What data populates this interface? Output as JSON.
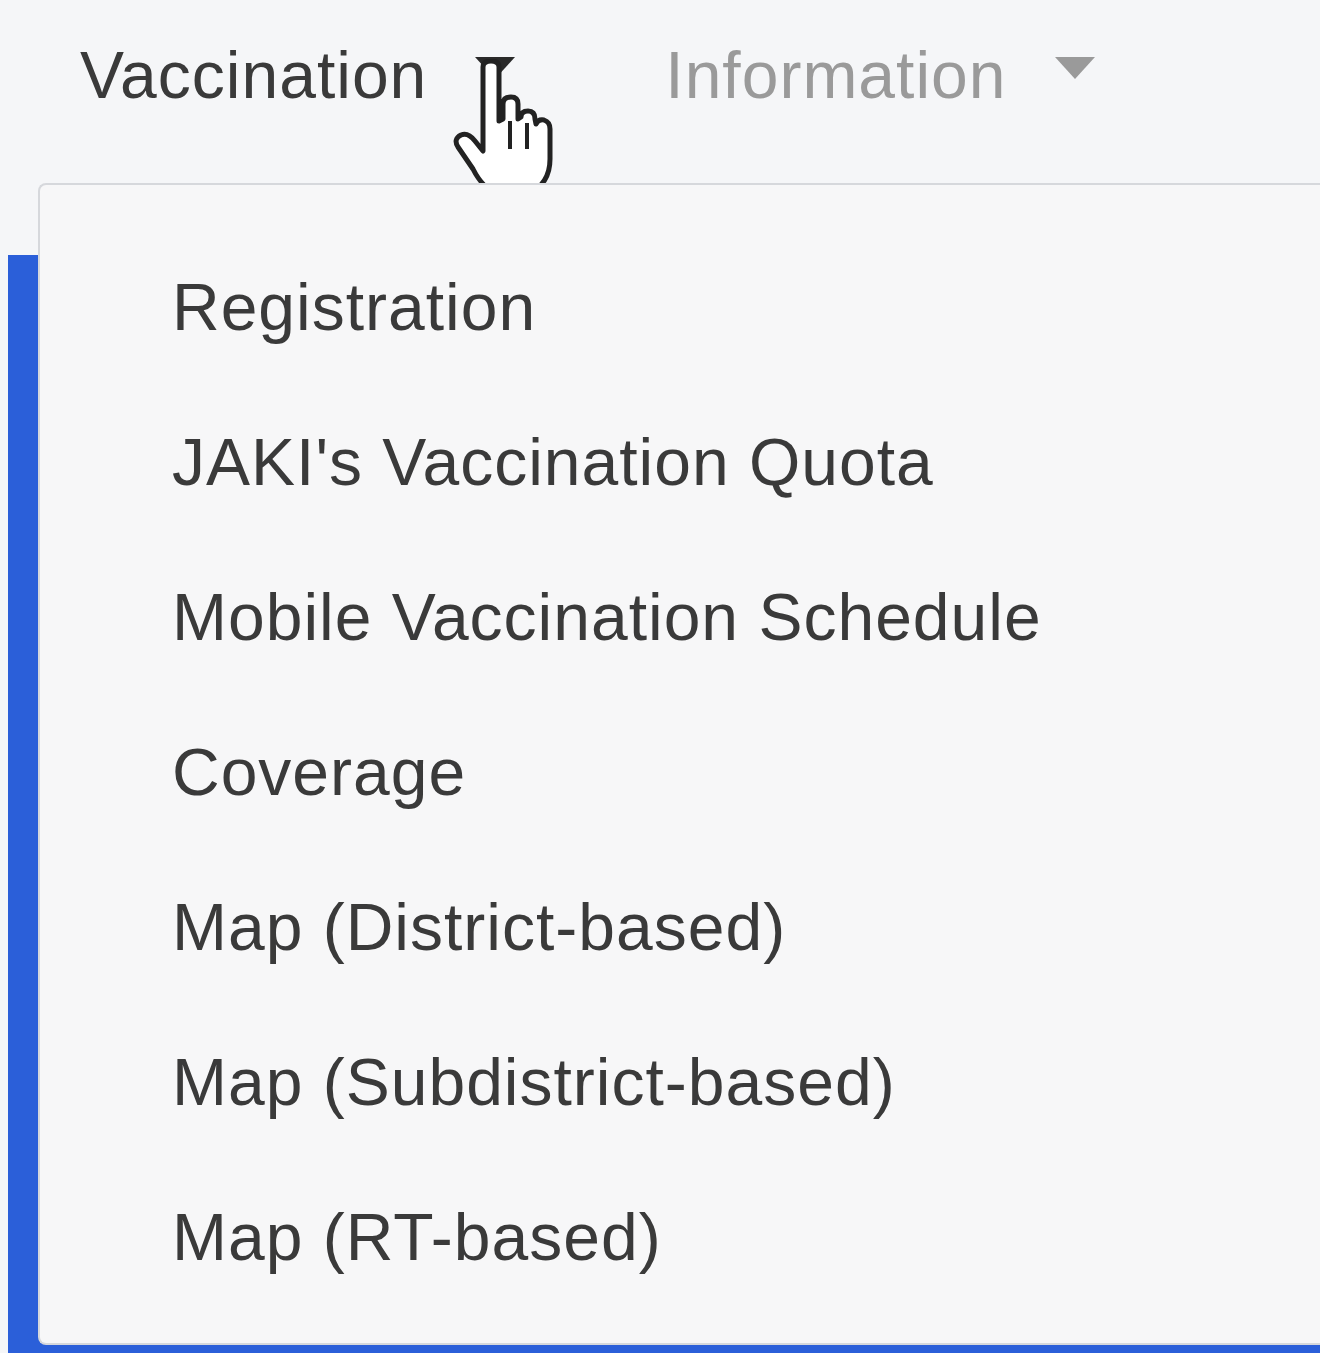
{
  "nav": [
    {
      "label": "Vaccination",
      "selected": true
    },
    {
      "label": "Information",
      "selected": false
    }
  ],
  "dropdown": {
    "items": [
      {
        "label": "Registration"
      },
      {
        "label": "JAKI's Vaccination Quota"
      },
      {
        "label": "Mobile Vaccination Schedule"
      },
      {
        "label": "Coverage"
      },
      {
        "label": "Map (District-based)"
      },
      {
        "label": "Map (Subdistrict-based)"
      },
      {
        "label": "Map (RT-based)"
      }
    ]
  }
}
